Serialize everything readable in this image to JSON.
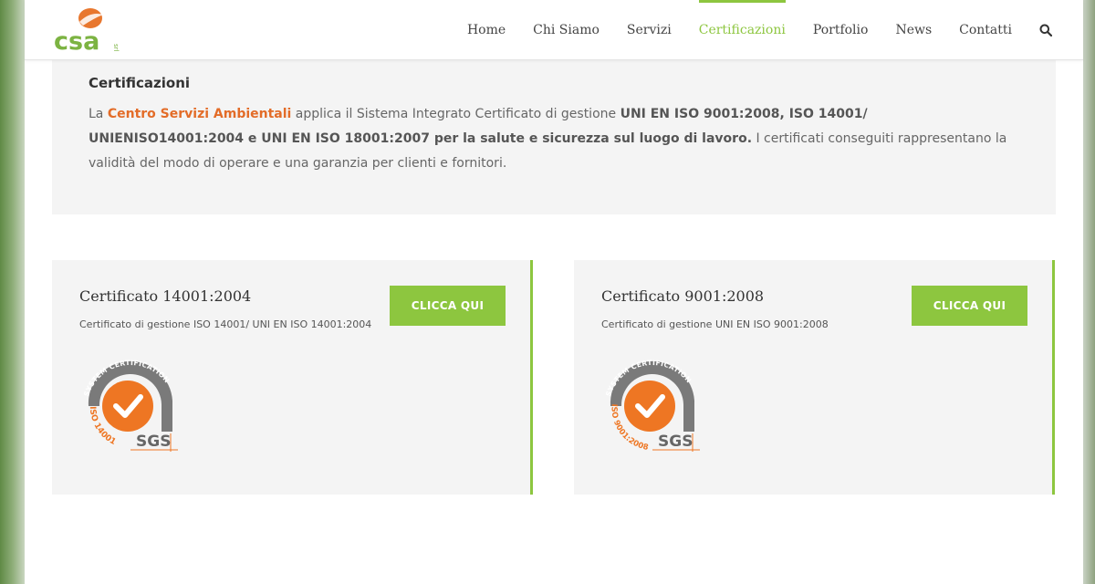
{
  "header": {
    "logo_text": "csa",
    "logo_small": "srl",
    "nav": [
      {
        "label": "Home",
        "active": false
      },
      {
        "label": "Chi Siamo",
        "active": false
      },
      {
        "label": "Servizi",
        "active": false
      },
      {
        "label": "Certificazioni",
        "active": true
      },
      {
        "label": "Portfolio",
        "active": false
      },
      {
        "label": "News",
        "active": false
      },
      {
        "label": "Contatti",
        "active": false
      }
    ],
    "search_icon": "search-icon"
  },
  "intro": {
    "title": "Certificazioni",
    "p_start": "La ",
    "brand": "Centro Servizi Ambientali",
    "p_mid": " applica il Sistema Integrato Certificato di gestione ",
    "strong": "UNI EN ISO 9001:2008, ISO 14001/ UNIENISO14001:2004 e UNI EN ISO 18001:2007 per la salute e sicurezza sul luogo di lavoro.",
    "p_end": " I certificati conseguiti rappresentano la validità del modo di operare e una garanzia per clienti e fornitori."
  },
  "cards": [
    {
      "title": "Certificato 14001:2004",
      "subtitle": "Certificato di gestione ISO 14001/ UNI EN ISO 14001:2004",
      "button": "CLICCA QUI",
      "badge_top": "SYSTEM CERTIFICATION",
      "badge_side": "ISO 14001",
      "badge_brand": "SGS"
    },
    {
      "title": "Certificato 9001:2008",
      "subtitle": "Certificato di gestione UNI EN ISO 9001:2008",
      "button": "CLICCA QUI",
      "badge_top": "SYSTEM CERTIFICATION",
      "badge_side": "ISO 9001:2008",
      "badge_brand": "SGS"
    }
  ],
  "colors": {
    "accent": "#8dc63f",
    "brand_orange": "#e36c28",
    "badge_grey": "#7a7a7a"
  }
}
